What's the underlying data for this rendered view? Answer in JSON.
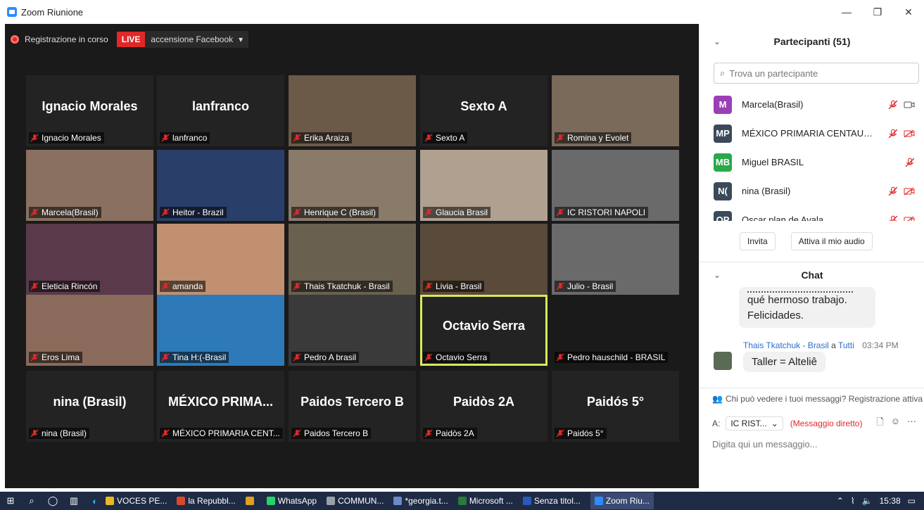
{
  "window": {
    "title": "Zoom Riunione"
  },
  "recording": {
    "status": "Registrazione in corso",
    "live": "LIVE",
    "stream": "accensione Facebook"
  },
  "tiles": [
    {
      "big": "Ignacio Morales",
      "name": "Ignacio Morales",
      "bg": "#232323"
    },
    {
      "big": "lanfranco",
      "name": "lanfranco",
      "bg": "#232323"
    },
    {
      "big": "",
      "name": "Erika Araiza",
      "bg": "#6b5a48"
    },
    {
      "big": "Sexto A",
      "name": "Sexto A",
      "bg": "#232323"
    },
    {
      "big": "",
      "name": "Romina y Evolet",
      "bg": "#7a6a5a"
    },
    {
      "big": "",
      "name": "Marcela(Brasil)",
      "bg": "#8a7060"
    },
    {
      "big": "",
      "name": "Heitor - Brazil",
      "bg": "#2a3e6a"
    },
    {
      "big": "",
      "name": "Henrique C (Brasil)",
      "bg": "#8a7a6a"
    },
    {
      "big": "",
      "name": "Glaucia Brasil",
      "bg": "#b0a090"
    },
    {
      "big": "",
      "name": "IC RISTORI NAPOLI",
      "bg": "#6a6a6a"
    },
    {
      "big": "",
      "name": "Eleticia Rincón",
      "bg": "#5a3a4a"
    },
    {
      "big": "",
      "name": "amanda",
      "bg": "#c09070"
    },
    {
      "big": "",
      "name": "Thais Tkatchuk - Brasil",
      "bg": "#6a6050"
    },
    {
      "big": "",
      "name": "Livia - Brasil",
      "bg": "#5a4a3a"
    },
    {
      "big": "",
      "name": "Julio - Brasil",
      "bg": "#6a6a6a"
    },
    {
      "big": "",
      "name": "Eros Lima",
      "bg": "#8a6a5a"
    },
    {
      "big": "",
      "name": "Tina H:(-Brasil",
      "bg": "#2e7ab8"
    },
    {
      "big": "",
      "name": "Pedro A brasil",
      "bg": "#3a3a3a"
    },
    {
      "big": "Octavio Serra",
      "name": "Octavio Serra",
      "bg": "#232323"
    },
    {
      "big": "",
      "name": "Pedro hauschild - BRASIL",
      "bg": "#1a1a1a"
    },
    {
      "big": "nina (Brasil)",
      "name": "nina (Brasil)",
      "bg": "#232323"
    },
    {
      "big": "MÉXICO  PRIMA...",
      "name": "MÉXICO PRIMARIA CENT...",
      "bg": "#232323"
    },
    {
      "big": "Paidos Tercero B",
      "name": "Paidos Tercero B",
      "bg": "#232323"
    },
    {
      "big": "Paidòs 2A",
      "name": "Paidòs 2A",
      "bg": "#232323"
    },
    {
      "big": "Paidós 5°",
      "name": "Paidós 5°",
      "bg": "#232323"
    }
  ],
  "participants": {
    "title": "Partecipanti (51)",
    "search_placeholder": "Trova un partecipante",
    "list": [
      {
        "initials": "M",
        "name": "Marcela(Brasil)",
        "color": "#9b3fb5",
        "video": "on"
      },
      {
        "initials": "MP",
        "name": "MÉXICO PRIMARIA CENTAURO ...",
        "color": "#3a4a5a",
        "video": "off"
      },
      {
        "initials": "MB",
        "name": "Miguel BRASIL",
        "color": "#2aa84a",
        "video": "none"
      },
      {
        "initials": "N(",
        "name": "nina (Brasil)",
        "color": "#3a4a5a",
        "video": "off"
      },
      {
        "initials": "OP",
        "name": "Oscar  plan de Avala",
        "color": "#3a4a5a",
        "video": "off"
      }
    ],
    "invite": "Invita",
    "audio": "Attiva il mio audio"
  },
  "chat": {
    "title": "Chat",
    "prev_bubble": "qué hermoso trabajo. Felicidades.",
    "sender": "Thais Tkatchuk - Brasil",
    "to_word": "a",
    "target": "Tutti",
    "time": "03:34 PM",
    "message": "Taller = Alteliê",
    "notice": "Chi può vedere i tuoi messaggi? Registrazione attiva",
    "to_label": "A:",
    "recipient": "IC RIST...",
    "direct": "(Messaggio diretto)",
    "input_placeholder": "Digita qui un messaggio..."
  },
  "taskbar": {
    "apps": [
      {
        "label": "VOCES PE...",
        "color": "#e8b820"
      },
      {
        "label": "la Repubbl...",
        "color": "#d84a2a"
      },
      {
        "label": "",
        "color": "#e0a020"
      },
      {
        "label": "WhatsApp",
        "color": "#25d366"
      },
      {
        "label": "COMMUN...",
        "color": "#9aa0a8"
      },
      {
        "label": "*georgia.t...",
        "color": "#6a8ac8"
      },
      {
        "label": "Microsoft ...",
        "color": "#2a7a3a"
      },
      {
        "label": "Senza titol...",
        "color": "#2a5ab8"
      },
      {
        "label": "Zoom Riu...",
        "color": "#2d8cff"
      }
    ],
    "time": "15:38"
  }
}
